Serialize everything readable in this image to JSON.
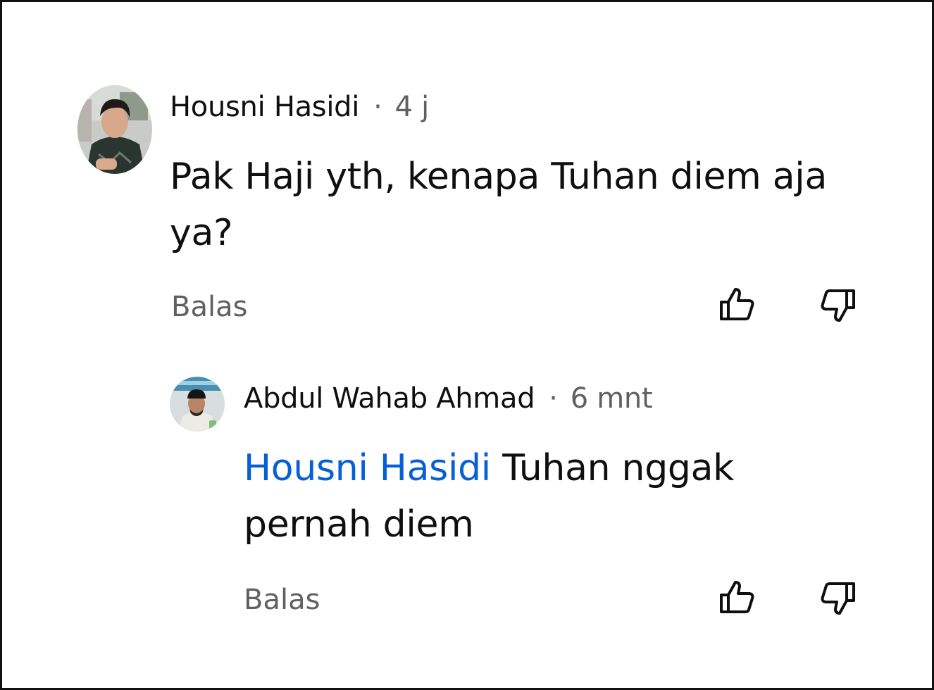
{
  "comment": {
    "author": "Housni Hasidi",
    "separator": "·",
    "time": "4 j",
    "text": "Pak Haji yth, kenapa Tuhan diem aja ya?",
    "reply_label": "Balas",
    "like_icon": "thumbs-up-icon",
    "dislike_icon": "thumbs-down-icon"
  },
  "reply": {
    "author": "Abdul Wahab Ahmad",
    "separator": "·",
    "time": "6 mnt",
    "mention": "Housni Hasidi",
    "text": " Tuhan nggak pernah diem",
    "reply_label": "Balas",
    "like_icon": "thumbs-up-icon",
    "dislike_icon": "thumbs-down-icon"
  },
  "colors": {
    "mention": "#065fd4",
    "secondary_text": "#606060",
    "primary_text": "#0f0f0f"
  }
}
